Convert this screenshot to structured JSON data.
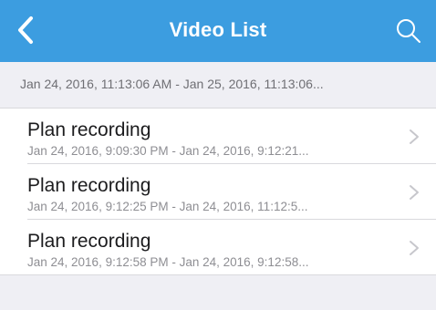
{
  "navbar": {
    "title": "Video List",
    "back_icon": "chevron-left-icon",
    "search_icon": "search-icon",
    "bg_color": "#3c9de0"
  },
  "range": {
    "text": "Jan 24, 2016, 11:13:06 AM - Jan 25, 2016, 11:13:06..."
  },
  "recordings": [
    {
      "title": "Plan recording",
      "time_range": "Jan 24, 2016, 9:09:30 PM - Jan 24, 2016, 9:12:21..."
    },
    {
      "title": "Plan recording",
      "time_range": "Jan 24, 2016, 9:12:25 PM - Jan 24, 2016, 11:12:5..."
    },
    {
      "title": "Plan recording",
      "time_range": "Jan 24, 2016, 9:12:58 PM - Jan 24, 2016, 9:12:58..."
    }
  ]
}
